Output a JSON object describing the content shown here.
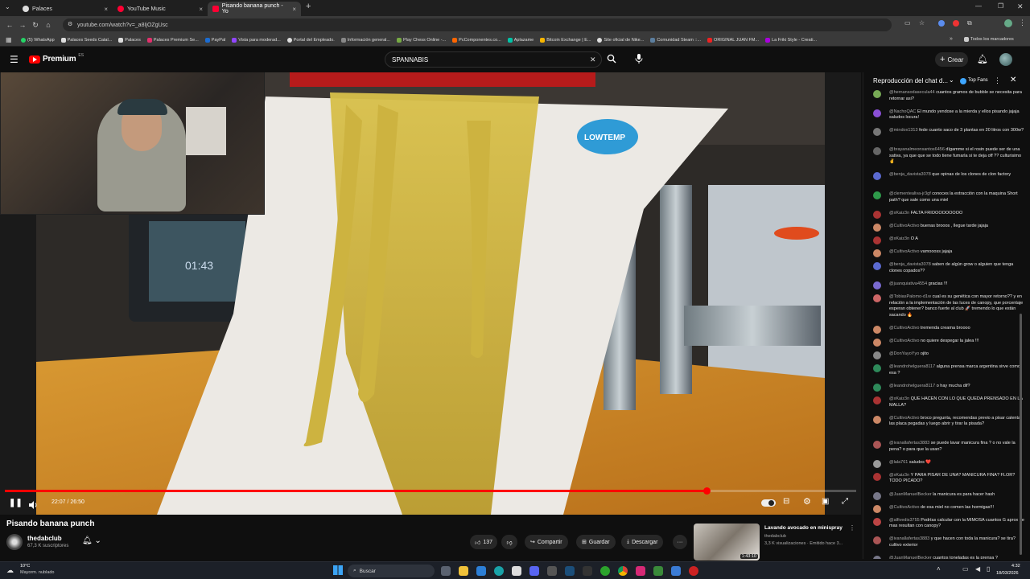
{
  "tabs": [
    {
      "title": "Palaces",
      "close": "×",
      "active": false
    },
    {
      "title": "YouTube Music",
      "close": "×",
      "active": false
    },
    {
      "title": "Pisando banana punch - Yo",
      "close": "×",
      "active": true
    }
  ],
  "new_tab": "+",
  "address": {
    "url": "youtube.com/watch?v=_a8IjOZgUsc"
  },
  "bookmarks": [
    "(5) WhatsApp",
    "Palaces Seeds Catal...",
    "Palaces",
    "Palaces Premium Se...",
    "PayPal",
    "Vista para moderad...",
    "Portal del Empleado.",
    "Información general...",
    "Play Chess Online -...",
    "PcComponentes.co...",
    "Aplazame",
    "Bitcoin Exchange | E...",
    "Site oficial de Nike...",
    "Comunidad Steam ::...",
    "ORIGINAL JUAN FM...",
    "La Friki Style - Creati..."
  ],
  "bookmarks_more": "»",
  "bookmarks_all": "Todos los marcadores",
  "youtube": {
    "logo": "Premium",
    "logo_sup": "ES",
    "search_value": "SPANNABIS",
    "search_clear": "✕",
    "create": "Crear"
  },
  "video": {
    "brand_label": "LOWTEMP",
    "time": "22:07 / 26:50",
    "progress": 0.824
  },
  "title": "Pisando banana punch",
  "channel": {
    "name": "thedabclub",
    "subs": "67,3 K suscriptores"
  },
  "actions": {
    "likes": "137",
    "share": "Compartir",
    "save": "Guardar",
    "download": "Descargar",
    "more": "···"
  },
  "recommend": {
    "title": "Lavando avocado en minispray",
    "channel": "thedabclub",
    "meta": "3,3 K visualizaciones · Emitido hace 3...",
    "duration": "1:43:10"
  },
  "chat": {
    "header": "Reproducción del chat d...",
    "top": "Top Fans",
    "messages": [
      {
        "author": "@hernansodasecula44",
        "text": "cuantos gramos de bubble se necesita para retornar asi?",
        "color": "#7a5"
      },
      {
        "author": "@NachoQAC",
        "text": "El mundo yendose a la mierda y ellos pisando jajaja saludos locura!",
        "color": "#8a4fd6"
      },
      {
        "author": "@mindox1313",
        "text": "fede cuanto saco de 3 plantas en 20 litros con 300w?",
        "color": "#777"
      },
      {
        "author": "@brayanalmeonsantos6456",
        "text": "dígamme si el rosin puede ser de una sativa, ya que que se todo tiene fumarla si te deja off ?? culturisimo ✌️",
        "color": "#666"
      },
      {
        "author": "@benja_davista3078",
        "text": "que opinas de los clones de clon factory",
        "color": "#5b6ad0"
      },
      {
        "author": "@clementealiva-jr3gf",
        "text": "conoces la extracción con la maquina Short path? que sale como una miel",
        "color": "#2e9a4a"
      },
      {
        "author": "@xKaiz3n",
        "text": "FALTA FRIOOOOOOOOO",
        "color": "#a33"
      },
      {
        "author": "@CultivoActivo",
        "text": "buenas brooos , llegue tarde jajaja",
        "color": "#c86"
      },
      {
        "author": "@xKaiz3n",
        "text": "O A",
        "color": "#a33"
      },
      {
        "author": "@CultivoActivo",
        "text": "vamoooss jajaja",
        "color": "#c86"
      },
      {
        "author": "@benja_davista3078",
        "text": "saben de algún grow o alguien que tenga clones copados??",
        "color": "#5b6ad0"
      },
      {
        "author": "@juanquiativa4554",
        "text": "gracias !!!",
        "color": "#7a6ad0"
      },
      {
        "author": "@TobiasPalomo-d1w",
        "text": "cual es su genética con mayor retorno?? y en relación a la implementación de las luces de canopy, que porcentaje esperan obtener? banco fuerte al club 🚀 tremendo lo que están sacando 🔥",
        "color": "#c66"
      },
      {
        "author": "@CultivoActivo",
        "text": "tremenda creama broooo",
        "color": "#c86"
      },
      {
        "author": "@CultivoActivo",
        "text": "no quiere despegar la jalea !!!",
        "color": "#c86"
      },
      {
        "author": "@DonYayoYyo",
        "text": "ojito",
        "color": "#888"
      },
      {
        "author": "@leandrohelguera8117",
        "text": "alguna prensa marca argentina sirve como esa ?",
        "color": "#2e8a5a"
      },
      {
        "author": "@leandrohelguera8117",
        "text": "o hay mucha dif?",
        "color": "#2e8a5a"
      },
      {
        "author": "@xKaiz3n",
        "text": "QUE HACEN CON LO QUE QUEDA PRENSADO EN LA MALLA?",
        "color": "#a33"
      },
      {
        "author": "@CultivoActivo",
        "text": "broco pregunta, recomendas previo a pisar calentar las placa pegadas y luego abrir y tirar la pisada?",
        "color": "#c86"
      },
      {
        "author": "@ivanallafertas3883",
        "text": "se puede lavar manicura fina ? o no vale la pena? o para que la usan?",
        "color": "#a55"
      },
      {
        "author": "@lala761",
        "text": "saludos ❤️",
        "color": "#999"
      },
      {
        "author": "@xKaiz3n",
        "text": "Y PARA PISAR DE UNA? MANICURA FINA? FLOR? TODO PICADO?",
        "color": "#a33"
      },
      {
        "author": "@JuanManuelBecker",
        "text": "la manicura es para hacer hash",
        "color": "#778"
      },
      {
        "author": "@CultivoActivo",
        "text": "de esa miel no comen las hormigas!!!",
        "color": "#c86"
      },
      {
        "author": "@alfivedis3755",
        "text": "Podrías calcular con la MIMOSA cuantos G aprox de mas resultan con canopy?",
        "color": "#b44"
      },
      {
        "author": "@ivanallafertas3883",
        "text": "y que hacen con toda la manicura? se tira? cultivo exterior",
        "color": "#a55"
      },
      {
        "author": "@JuanManuelBecker",
        "text": "cuantos toneladas es la prensa ?",
        "color": "#778"
      }
    ]
  },
  "taskbar": {
    "weather_temp": "10°C",
    "weather_desc": "Mayorm. nublado",
    "search": "Buscar",
    "time": "4:32",
    "date": "18/03/2026"
  }
}
